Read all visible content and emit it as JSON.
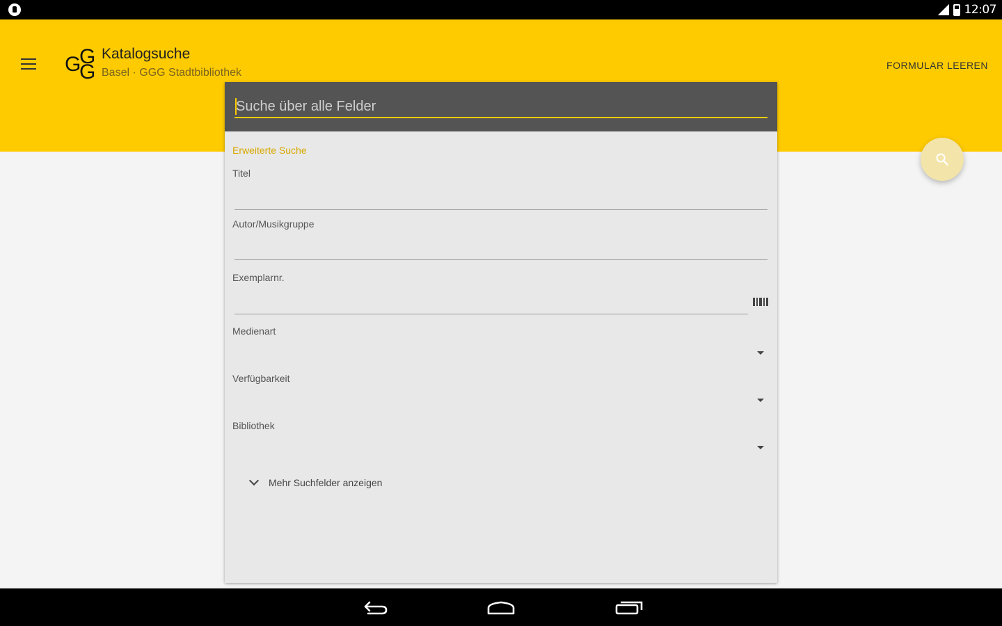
{
  "status_bar": {
    "time": "12:07",
    "left_icon": "shield-lock-icon",
    "signal_icon": "signal-icon",
    "battery_icon": "battery-icon"
  },
  "app_bar": {
    "menu_icon": "menu-icon",
    "logo_text": "GGG",
    "title": "Katalogsuche",
    "subtitle": "Basel · GGG Stadtbibliothek",
    "clear_action": "FORMULAR LEEREN",
    "background_color": "#fecb00"
  },
  "search": {
    "placeholder": "Suche über alle Felder",
    "value": ""
  },
  "advanced": {
    "section_label": "Erweiterte Suche",
    "fields": {
      "title": {
        "label": "Titel",
        "value": ""
      },
      "author": {
        "label": "Autor/Musikgruppe",
        "value": ""
      },
      "copy": {
        "label": "Exemplarnr.",
        "value": "",
        "icon": "barcode-icon"
      },
      "media_type": {
        "label": "Medienart",
        "value": ""
      },
      "availability": {
        "label": "Verfügbarkeit",
        "value": ""
      },
      "library": {
        "label": "Bibliothek",
        "value": ""
      }
    },
    "more_fields": "Mehr Suchfelder anzeigen"
  },
  "fab": {
    "icon": "search-icon",
    "color": "#f3e4a9"
  },
  "nav_bar": {
    "back_icon": "back-icon",
    "home_icon": "home-icon",
    "recents_icon": "recent-apps-icon"
  }
}
